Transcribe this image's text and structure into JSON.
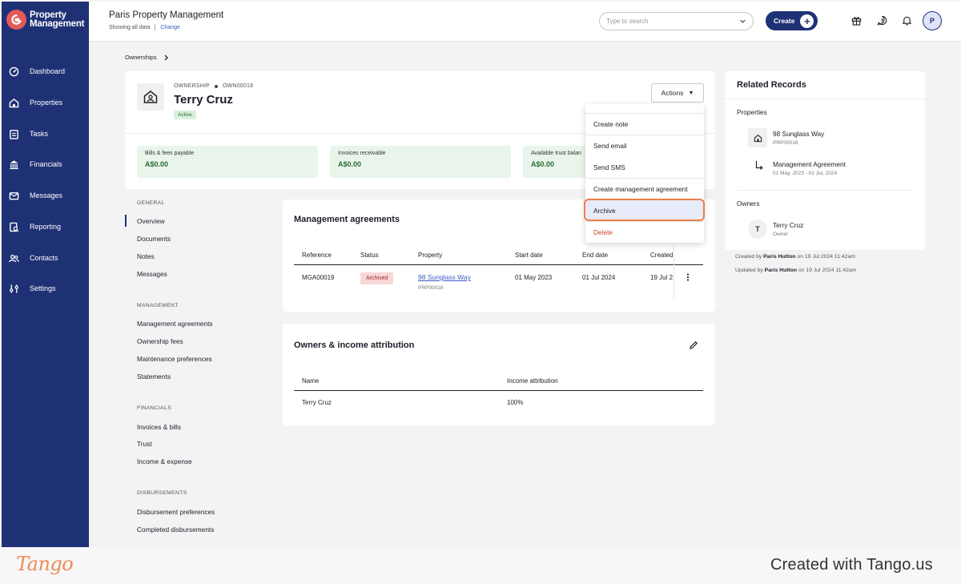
{
  "app": {
    "brand_line1": "Property",
    "brand_line2": "Management",
    "brand_color": "#1f3175",
    "accent_color": "#e4595a"
  },
  "topbar": {
    "org_title": "Paris Property Management",
    "showing": "Showing all data",
    "change_link": "Change",
    "search_placeholder": "Type to search",
    "create_label": "Create",
    "avatar_initial": "P"
  },
  "sidebar": {
    "items": [
      {
        "label": "Dashboard",
        "icon": "dashboard-icon"
      },
      {
        "label": "Properties",
        "icon": "home-icon"
      },
      {
        "label": "Tasks",
        "icon": "tasks-icon"
      },
      {
        "label": "Financials",
        "icon": "bank-icon"
      },
      {
        "label": "Messages",
        "icon": "mail-icon"
      },
      {
        "label": "Reporting",
        "icon": "report-icon"
      },
      {
        "label": "Contacts",
        "icon": "contacts-icon"
      },
      {
        "label": "Settings",
        "icon": "settings-icon"
      }
    ]
  },
  "breadcrumb": {
    "label": "Ownerships"
  },
  "ownership": {
    "kicker": "OWNERSHIP",
    "id": "OWN00018",
    "name": "Terry Cruz",
    "status": "Active",
    "actions_label": "Actions"
  },
  "stats": [
    {
      "label": "Bills & fees payable",
      "value": "A$0.00"
    },
    {
      "label": "Invoices receivable",
      "value": "A$0.00"
    },
    {
      "label": "Available trust balan",
      "value": "A$0.00"
    }
  ],
  "subnav": {
    "general_title": "GENERAL",
    "general": [
      "Overview",
      "Documents",
      "Notes",
      "Messages"
    ],
    "management_title": "MANAGEMENT",
    "management": [
      "Management agreements",
      "Ownership fees",
      "Maintenance preferences",
      "Statements"
    ],
    "financials_title": "FINANCIALS",
    "financials": [
      "Invoices & bills",
      "Trust",
      "Income & expense"
    ],
    "disbursements_title": "DISBURSEMENTS",
    "disbursements": [
      "Disbursement preferences",
      "Completed disbursements"
    ]
  },
  "management_agreements": {
    "title": "Management agreements",
    "columns": [
      "Reference",
      "Status",
      "Property",
      "Start date",
      "End date",
      "Created"
    ],
    "row": {
      "reference": "MGA00019",
      "status": "Archived",
      "property": "98 Sunglass Way",
      "property_id": "PRP00018",
      "start": "01 May 2023",
      "end": "01 Jul 2024",
      "created": "19 Jul 2"
    }
  },
  "owners_income": {
    "title": "Owners & income attribution",
    "columns": [
      "Name",
      "Income attribution"
    ],
    "row": {
      "name": "Terry Cruz",
      "attribution": "100%"
    }
  },
  "related": {
    "title": "Related Records",
    "properties_title": "Properties",
    "property_name": "98 Sunglass Way",
    "property_id": "PRP00018",
    "agreement_name": "Management Agreement",
    "agreement_dates": "01 May, 2023 - 01 Jul, 2024",
    "owners_title": "Owners",
    "owner_initial": "T",
    "owner_name": "Terry Cruz",
    "owner_role": "Owner"
  },
  "audit": {
    "created_prefix": "Created by",
    "created_by": "Paris Hutton",
    "created_suffix": "on 19 Jul 2024 11:42am",
    "updated_prefix": "Updated by",
    "updated_by": "Paris Hutton",
    "updated_suffix": "on 19 Jul 2024 11:42am"
  },
  "menu": {
    "items": [
      "Create note",
      "Send email",
      "Send SMS",
      "Create management agreement",
      "Archive",
      "Delete"
    ],
    "delete_color": "#d0452e",
    "highlight_color": "#ee7e4a"
  },
  "footer": {
    "logo": "Tango",
    "credit": "Created with Tango.us"
  }
}
